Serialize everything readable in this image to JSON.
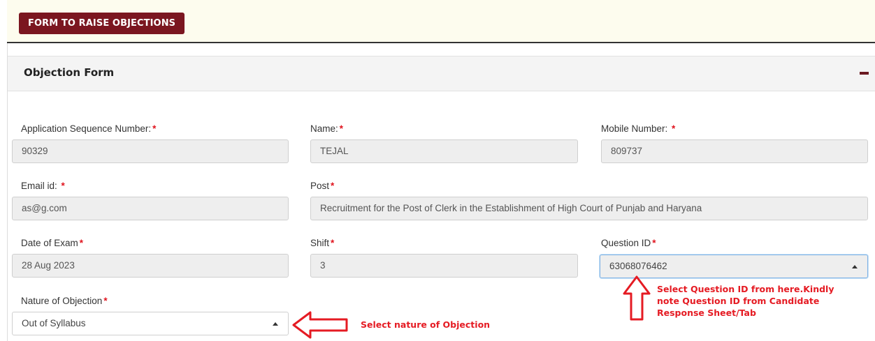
{
  "header": {
    "title": "FORM TO RAISE OBJECTIONS"
  },
  "panel": {
    "title": "Objection Form",
    "collapse_icon": "minus-icon"
  },
  "fields": {
    "asn": {
      "label": "Application Sequence Number:",
      "required": "*",
      "value": "90329"
    },
    "name": {
      "label": "Name:",
      "required": "*",
      "value": "TEJAL"
    },
    "mobile": {
      "label": "Mobile Number: ",
      "required": "*",
      "value": "809737"
    },
    "email": {
      "label": "Email id: ",
      "required": "*",
      "value": "as@g.com"
    },
    "post": {
      "label": "Post",
      "required": "*",
      "value": "Recruitment for the Post of Clerk in the Establishment of High Court of Punjab and Haryana"
    },
    "date": {
      "label": "Date of Exam",
      "required": "*",
      "value": "28 Aug 2023"
    },
    "shift": {
      "label": "Shift",
      "required": "*",
      "value": "3"
    },
    "question_id": {
      "label": "Question ID",
      "required": "*",
      "value": "63068076462"
    },
    "nature": {
      "label": "Nature of Objection",
      "required": "*",
      "value": "Out of Syllabus"
    }
  },
  "annotations": {
    "question_id_note": [
      "Select Question ID from here.Kindly",
      "note Question ID from Candidate",
      "Response Sheet/Tab"
    ],
    "nature_note": "Select nature of Objection"
  },
  "colors": {
    "brand": "#7b1620",
    "required": "#e0141e",
    "annotation": "#e51b23"
  }
}
